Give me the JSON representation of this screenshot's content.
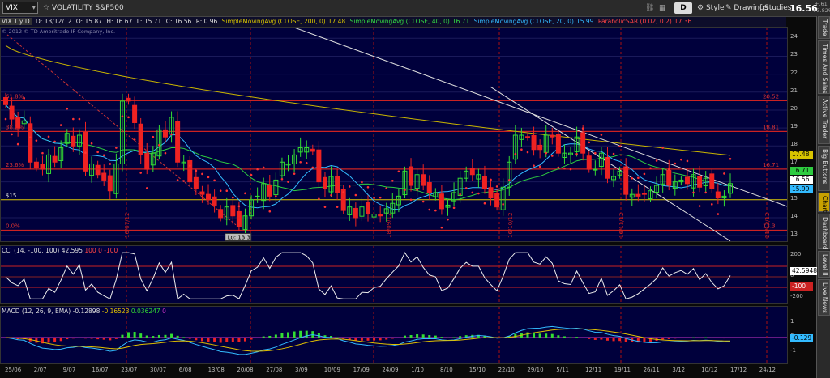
{
  "toolbar": {
    "symbol": "VIX",
    "title": "VOLATILITY S&P500",
    "period": "D",
    "style_label": "Style",
    "drawings_label": "Drawings",
    "studies_label": "Studies",
    "last_price": "16.56",
    "change": "+.61",
    "change_pct": "+3.82%"
  },
  "study_header": {
    "period": "VIX 1 y D",
    "date": "D: 13/12/12",
    "open": "O: 15.87",
    "high": "H: 16.67",
    "low": "L: 15.71",
    "close": "C: 16.56",
    "r": "R: 0.96",
    "sma200": "SimpleMovingAvg (CLOSE, 200, 0)",
    "sma200_val": "17.48",
    "sma40": "SimpleMovingAvg (CLOSE, 40, 0)",
    "sma40_val": "16.71",
    "sma20": "SimpleMovingAvg (CLOSE, 20, 0)",
    "sma20_val": "15.99",
    "psar": "ParabolicSAR (0.02, 0.2)",
    "psar_val": "17.36"
  },
  "copyright": "© 2012 © TD Ameritrade IP Company, Inc.",
  "tabs": [
    "Trade",
    "Times And Sales",
    "Active Trader",
    "Big Buttons",
    "Chart",
    "Dashboard",
    "Level II",
    "Live News"
  ],
  "active_tab": "Chart",
  "price_panel": {
    "y_ticks": [
      "24",
      "23",
      "22",
      "21",
      "20",
      "19",
      "18",
      "17",
      "16",
      "15",
      "14",
      "13"
    ],
    "fib_labels": [
      "61.8%",
      "38.2%",
      "23.6%",
      "0.0%"
    ],
    "fib_right": [
      "20.52",
      "18.81",
      "16.71",
      "13.3"
    ],
    "level_label": "$15",
    "low_label": "Lo: 13.3",
    "tags": {
      "sma200": "17.48",
      "last": "16.56",
      "sma20": "15.99",
      "sma40": "16.71"
    },
    "vertical_dates": [
      "16/07/12",
      "18/09/12",
      "16/10/12",
      "16/11/12",
      "21/12/12"
    ]
  },
  "cci": {
    "label": "CCI (14, -100, 100)",
    "value": "42.595",
    "upper": "100",
    "zero": "0",
    "lower": "-100",
    "y_ticks": [
      "200",
      "0",
      "-200"
    ],
    "tags": {
      "value": "42.5948",
      "lower": "-100"
    }
  },
  "macd": {
    "label": "MACD (12, 26, 9, EMA)",
    "value": "-0.12898",
    "avg": "-0.16523",
    "diff": "0.036247",
    "zero": "0",
    "y_ticks": [
      "1",
      "0",
      "-1"
    ],
    "tag": "-0.129"
  },
  "x_axis": [
    "25/06",
    "2/07",
    "9/07",
    "16/07",
    "23/07",
    "30/07",
    "6/08",
    "13/08",
    "20/08",
    "27/08",
    "3/09",
    "10/09",
    "17/09",
    "24/09",
    "1/10",
    "8/10",
    "15/10",
    "22/10",
    "29/10",
    "5/11",
    "12/11",
    "19/11",
    "26/11",
    "3/12",
    "10/12",
    "17/12",
    "24/12"
  ],
  "colors": {
    "bg": "#00003c",
    "up": "#33dd33",
    "down": "#ee2222",
    "sma200": "#c8b400",
    "sma40": "#2ecc40",
    "sma20": "#33bbff",
    "psar": "#ff3333",
    "fib": "#cc2222",
    "trend": "#dddddd"
  },
  "chart_data": {
    "type": "candlestick",
    "symbol": "VIX",
    "aggregation": "1 y D",
    "ylim": [
      12.6,
      24.6
    ],
    "x": [
      "2012-06-25",
      "2012-06-26",
      "2012-06-27",
      "2012-06-28",
      "2012-06-29",
      "2012-07-02",
      "2012-07-03",
      "2012-07-05",
      "2012-07-06",
      "2012-07-09",
      "2012-07-10",
      "2012-07-11",
      "2012-07-12",
      "2012-07-13",
      "2012-07-16",
      "2012-07-17",
      "2012-07-18",
      "2012-07-19",
      "2012-07-20",
      "2012-07-23",
      "2012-07-24",
      "2012-07-25",
      "2012-07-26",
      "2012-07-27",
      "2012-07-30",
      "2012-07-31",
      "2012-08-01",
      "2012-08-02",
      "2012-08-03",
      "2012-08-06",
      "2012-08-07",
      "2012-08-08",
      "2012-08-09",
      "2012-08-10",
      "2012-08-13",
      "2012-08-14",
      "2012-08-15",
      "2012-08-16",
      "2012-08-17",
      "2012-08-20",
      "2012-08-21",
      "2012-08-22",
      "2012-08-23",
      "2012-08-24",
      "2012-08-27",
      "2012-08-28",
      "2012-08-29",
      "2012-08-30",
      "2012-08-31",
      "2012-09-04",
      "2012-09-05",
      "2012-09-06",
      "2012-09-07",
      "2012-09-10",
      "2012-09-11",
      "2012-09-12",
      "2012-09-13",
      "2012-09-14",
      "2012-09-17",
      "2012-09-18",
      "2012-09-19",
      "2012-09-20",
      "2012-09-21",
      "2012-09-24",
      "2012-09-25",
      "2012-09-26",
      "2012-09-27",
      "2012-09-28",
      "2012-10-01",
      "2012-10-02",
      "2012-10-03",
      "2012-10-04",
      "2012-10-05",
      "2012-10-08",
      "2012-10-09",
      "2012-10-10",
      "2012-10-11",
      "2012-10-12",
      "2012-10-15",
      "2012-10-16",
      "2012-10-17",
      "2012-10-18",
      "2012-10-19",
      "2012-10-22",
      "2012-10-23",
      "2012-10-24",
      "2012-10-25",
      "2012-10-26",
      "2012-10-31",
      "2012-11-01",
      "2012-11-02",
      "2012-11-05",
      "2012-11-06",
      "2012-11-07",
      "2012-11-08",
      "2012-11-09",
      "2012-11-12",
      "2012-11-13",
      "2012-11-14",
      "2012-11-15",
      "2012-11-16",
      "2012-11-19",
      "2012-11-20",
      "2012-11-21",
      "2012-11-23",
      "2012-11-26",
      "2012-11-27",
      "2012-11-28",
      "2012-11-29",
      "2012-11-30",
      "2012-12-03",
      "2012-12-04",
      "2012-12-05",
      "2012-12-06",
      "2012-12-07",
      "2012-12-10",
      "2012-12-11",
      "2012-12-12",
      "2012-12-13"
    ],
    "close": [
      20.3,
      19.5,
      19.0,
      19.4,
      17.1,
      16.8,
      16.7,
      17.5,
      17.1,
      17.9,
      18.7,
      18.0,
      18.6,
      16.6,
      17.0,
      16.4,
      16.1,
      15.5,
      17.0,
      20.5,
      20.5,
      19.3,
      17.5,
      16.7,
      17.6,
      18.9,
      18.5,
      19.6,
      17.1,
      17.1,
      16.0,
      15.6,
      15.3,
      15.0,
      14.7,
      14.0,
      14.6,
      14.1,
      13.5,
      14.1,
      15.0,
      15.2,
      15.9,
      15.2,
      16.1,
      17.1,
      17.0,
      17.5,
      17.9,
      17.9,
      17.7,
      16.0,
      15.6,
      16.3,
      15.4,
      14.4,
      14.6,
      14.0,
      14.6,
      14.2,
      14.2,
      14.1,
      14.5,
      14.8,
      15.2,
      16.6,
      15.8,
      16.4,
      15.8,
      15.4,
      15.4,
      14.5,
      14.7,
      15.4,
      16.2,
      16.6,
      16.4,
      16.4,
      15.6,
      15.1,
      14.6,
      15.7,
      17.1,
      18.6,
      18.6,
      18.5,
      17.8,
      17.8,
      18.6,
      18.5,
      17.6,
      17.6,
      17.6,
      18.5,
      17.6,
      16.7,
      16.7,
      17.6,
      16.2,
      16.3,
      16.6,
      15.3,
      15.3,
      15.2,
      15.3,
      15.5,
      15.8,
      16.4,
      15.8,
      16.0,
      16.1,
      15.9,
      16.4,
      15.7,
      16.2,
      15.6,
      15.1,
      15.2,
      15.9
    ],
    "series": [
      {
        "name": "SimpleMovingAvg (CLOSE, 200, 0)",
        "last": 17.48
      },
      {
        "name": "SimpleMovingAvg (CLOSE, 40, 0)",
        "last": 16.71
      },
      {
        "name": "SimpleMovingAvg (CLOSE, 20, 0)",
        "last": 15.99
      },
      {
        "name": "ParabolicSAR (0.02, 0.2)",
        "last": 17.36
      }
    ],
    "fib_levels": [
      {
        "label": "61.8%",
        "value": 20.52
      },
      {
        "label": "38.2%",
        "value": 18.81
      },
      {
        "label": "23.6%",
        "value": 16.71
      },
      {
        "label": "0.0%",
        "value": 13.3
      }
    ],
    "horizontal_level": 15,
    "low_annotation": 13.3,
    "last": 16.56
  }
}
